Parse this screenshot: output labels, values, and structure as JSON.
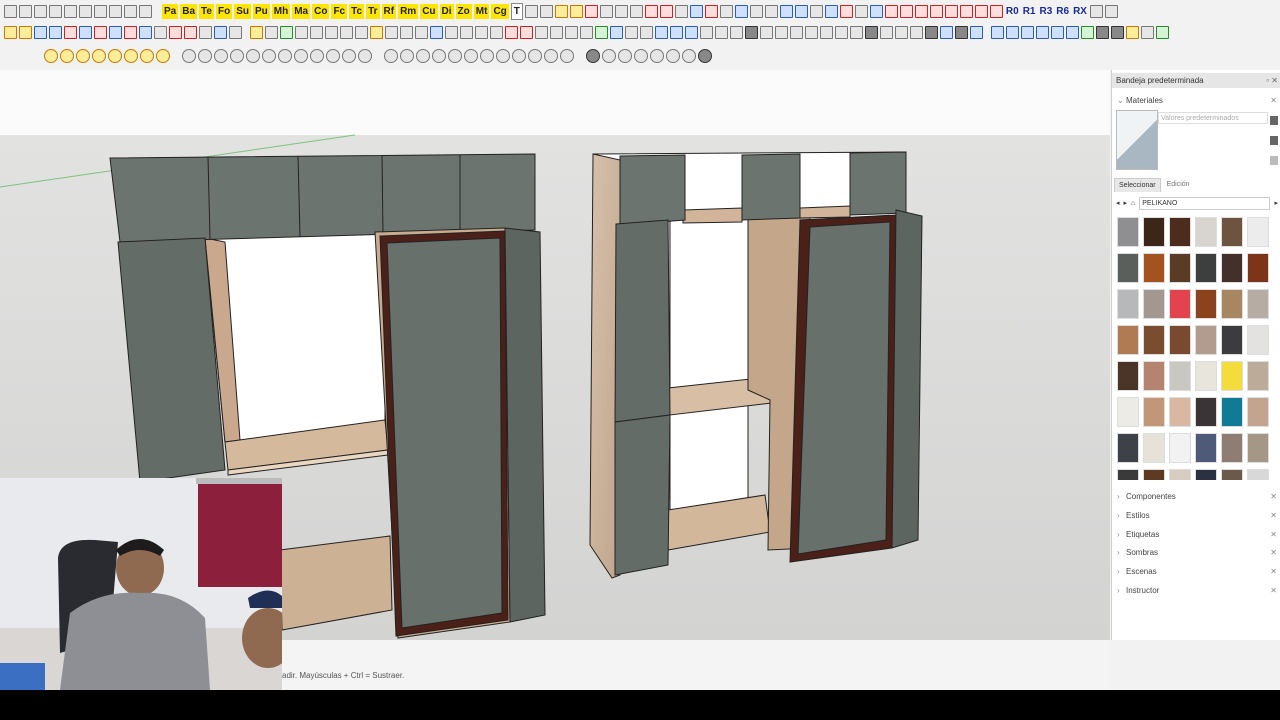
{
  "toolbar_labels": {
    "row1": [
      "Pa",
      "Ba",
      "Te",
      "Fo",
      "Su",
      "Pu",
      "Mh",
      "Ma",
      "Co",
      "Fc",
      "Tc",
      "Tr",
      "Rf",
      "Rm",
      "Cu",
      "Di",
      "Zo",
      "Mt",
      "Cg",
      "T"
    ],
    "right": [
      "R0",
      "R1",
      "R3",
      "R6",
      "RX"
    ]
  },
  "tray": {
    "title": "Bandeja predeterminada",
    "materials": {
      "header": "Materiales",
      "name_placeholder": "Valores predeterminados",
      "tabs": [
        "Seleccionar",
        "Edición"
      ],
      "library": "PELIKANO",
      "swatch_colors": [
        "#8f8f91",
        "#3b2618",
        "#4c2c1c",
        "#d8d5d0",
        "#6e5440",
        "#ececec",
        "#5a5f5c",
        "#a3531f",
        "#5a3b24",
        "#3d3f3f",
        "#43302a",
        "#7d3519",
        "#b6b8ba",
        "#a39890",
        "#e3434f",
        "#8a431e",
        "#a98662",
        "#b7aca4",
        "#b07a52",
        "#7a4d2f",
        "#7a4a30",
        "#b29b8f",
        "#3c3c3e",
        "#e4e2e0",
        "#4b3529",
        "#b58470",
        "#c9c7c2",
        "#e8e6dc",
        "#f3dc3c",
        "#bcab98",
        "#ecebe6",
        "#c29778",
        "#d8b8a0",
        "#3b3436",
        "#117a95",
        "#c3a58f",
        "#3e4248",
        "#e6e2d8",
        "#f2f2f2",
        "#4f5a78",
        "#8d7d72",
        "#a49786",
        "#3a3a3a",
        "#5e3a22",
        "#d8cdc0",
        "#2b3140",
        "#6b5a4c",
        "#d8d8d8"
      ]
    },
    "panels": [
      "Componentes",
      "Estilos",
      "Etiquetas",
      "Sombras",
      "Escenas",
      "Instructor"
    ]
  },
  "status_text": "adir. Mayúsculas + Ctrl = Sustraer."
}
